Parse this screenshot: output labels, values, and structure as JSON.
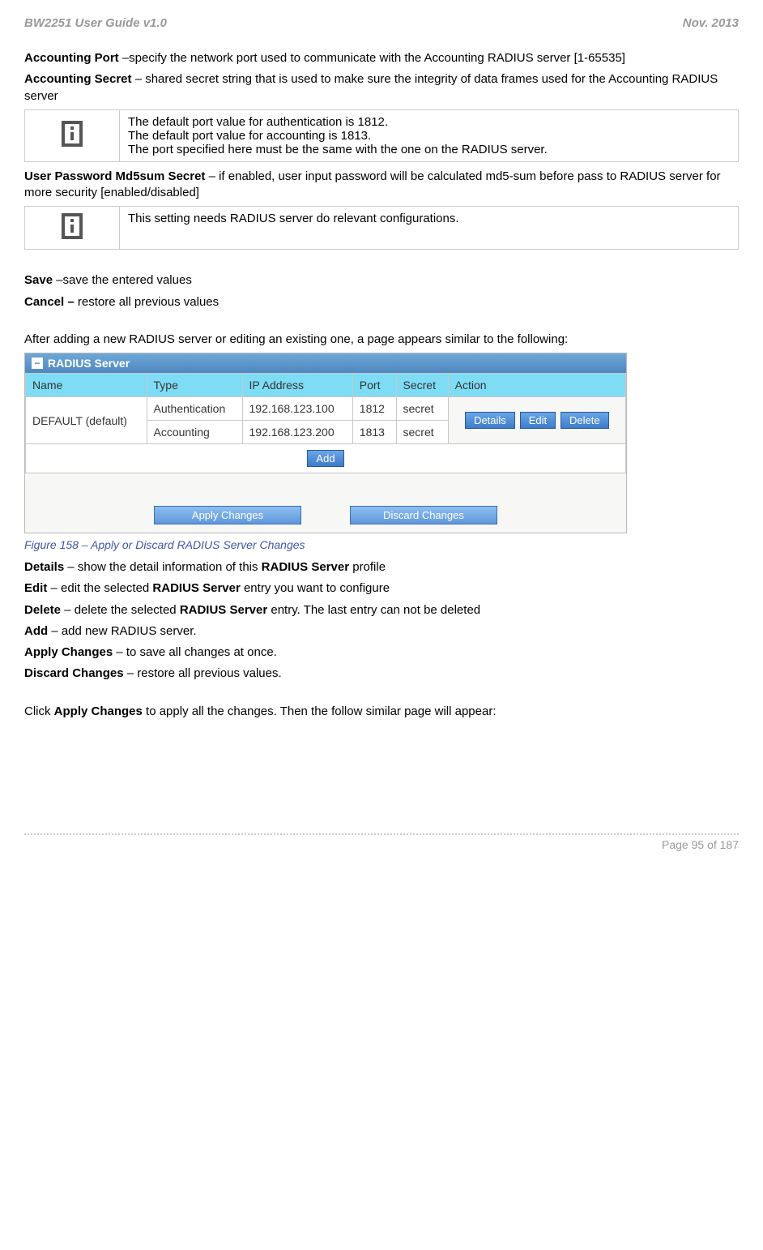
{
  "header": {
    "left": "BW2251 User Guide v1.0",
    "right": "Nov.  2013"
  },
  "p1a": "Accounting Port ",
  "p1b": "–specify the network port used to communicate with the Accounting RADIUS server [1-65535]",
  "p2a": "Accounting Secret ",
  "p2b": "– shared secret string that is used to make sure the integrity of data frames used for the Accounting RADIUS server",
  "info1": {
    "l1": "The default port value for authentication is 1812.",
    "l2": "The default port value for accounting is 1813.",
    "l3": "The port specified here must be the same with the one on the RADIUS server."
  },
  "p3a": "User Password Md5sum Secret ",
  "p3b": "– if enabled, user input password will be calculated md5-sum before pass to RADIUS server for more security [enabled/disabled]",
  "info2": {
    "l1": "This setting needs RADIUS server do relevant configurations."
  },
  "p4a": "Save ",
  "p4b": "–save the entered values",
  "p5a": "Cancel – ",
  "p5b": "restore all previous values",
  "p6": "After adding a new RADIUS server or editing an existing one, a page appears similar to the following:",
  "scr": {
    "title": "RADIUS Server",
    "cols": {
      "c1": "Name",
      "c2": "Type",
      "c3": "IP Address",
      "c4": "Port",
      "c5": "Secret",
      "c6": "Action"
    },
    "rowname": "DEFAULT (default)",
    "r1": {
      "type": "Authentication",
      "ip": "192.168.123.100",
      "port": "1812",
      "secret": "secret"
    },
    "r2": {
      "type": "Accounting",
      "ip": "192.168.123.200",
      "port": "1813",
      "secret": "secret"
    },
    "btnDetails": "Details",
    "btnEdit": "Edit",
    "btnDelete": "Delete",
    "btnAdd": "Add",
    "btnApply": "Apply Changes",
    "btnDiscard": "Discard Changes"
  },
  "caption": "Figure 158 – Apply or Discard RADIUS Server Changes",
  "d1a": "Details ",
  "d1b": "– show the detail information of this ",
  "d1c": "RADIUS Server ",
  "d1d": "profile",
  "d2a": "Edit ",
  "d2b": "– edit the selected ",
  "d2c": "RADIUS Server ",
  "d2d": "entry you want to configure",
  "d3a": "Delete ",
  "d3b": "– delete the selected ",
  "d3c": "RADIUS Server ",
  "d3d": "entry. The last entry can not be deleted",
  "d4a": "Add ",
  "d4b": "– add new RADIUS server.",
  "d5a": "Apply Changes ",
  "d5b": "– to save all changes at once.",
  "d6a": "Discard Changes ",
  "d6b": "– restore all previous values.",
  "p7a": "Click ",
  "p7b": "Apply Changes",
  "p7c": " to apply all the changes. Then the follow similar page will appear:",
  "footer": "Page 95 of 187"
}
